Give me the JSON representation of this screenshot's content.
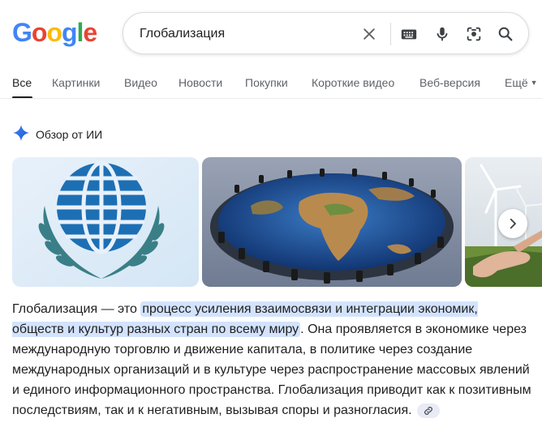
{
  "logo": {
    "letters": [
      "G",
      "o",
      "o",
      "g",
      "l",
      "e"
    ],
    "colors": [
      "#4285f4",
      "#ea4335",
      "#fbbc05",
      "#4285f4",
      "#34a853",
      "#ea4335"
    ]
  },
  "search": {
    "query": "Глобализация"
  },
  "tabs": [
    {
      "label": "Все",
      "active": true
    },
    {
      "label": "Картинки"
    },
    {
      "label": "Видео"
    },
    {
      "label": "Новости"
    },
    {
      "label": "Покупки"
    },
    {
      "label": "Короткие видео"
    },
    {
      "label": "Веб-версия"
    },
    {
      "label": "Ещё"
    }
  ],
  "ai_overview": {
    "title": "Обзор от ИИ",
    "summary_before": "Глобализация — это ",
    "summary_highlight": "процесс усиления взаимосвязи и интеграции экономик, обществ и культур разных стран по всему миру",
    "summary_after": ". Она проявляется в экономике через международную торговлю и движение капитала, в политике через создание международных организаций и в культуре через распространение массовых явлений и единого информационного пространства. Глобализация приводит как к позитивным последствиям, так и к негативным, вызывая споры и разногласия."
  },
  "icons": {
    "clear": "close-icon",
    "keyboard": "keyboard-icon",
    "voice": "microphone-icon",
    "lens": "camera-lens-icon",
    "search": "search-icon",
    "sparkle": "gemini-sparkle-icon",
    "next": "chevron-right-icon",
    "link": "link-icon"
  },
  "colors": {
    "accent": "#1a73e8",
    "highlight": "#d3e3fd"
  }
}
